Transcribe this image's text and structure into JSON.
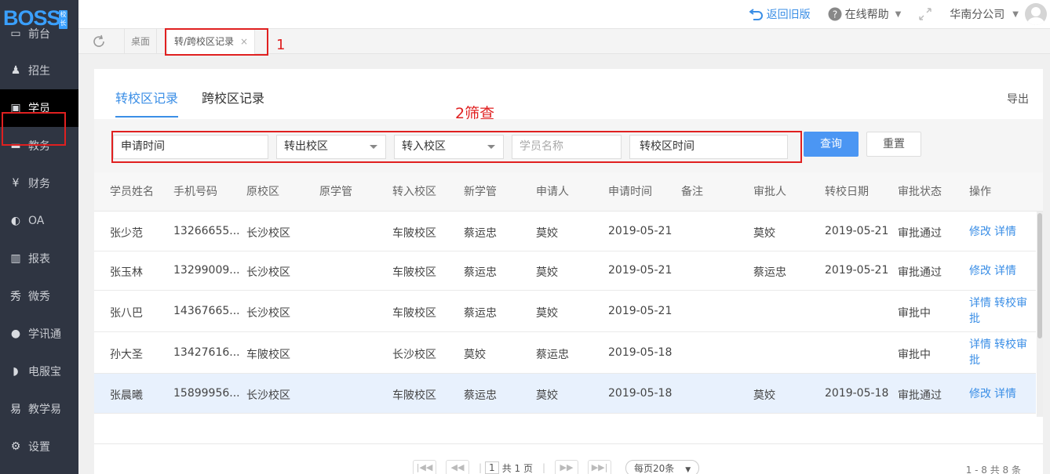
{
  "brand": {
    "logo": "BOSS",
    "badge": "校长"
  },
  "sidebar": {
    "items": [
      {
        "label": "前台",
        "icon": "window-icon"
      },
      {
        "label": "招生",
        "icon": "add-user-icon"
      },
      {
        "label": "学员",
        "icon": "student-card-icon"
      },
      {
        "label": "教务",
        "icon": "board-icon"
      },
      {
        "label": "财务",
        "icon": "yen-coin-icon"
      },
      {
        "label": "OA",
        "icon": "toggle-icon"
      },
      {
        "label": "报表",
        "icon": "bar-chart-icon"
      },
      {
        "label": "微秀",
        "icon": "wechat-show-icon"
      },
      {
        "label": "学讯通",
        "icon": "location-pin-icon"
      },
      {
        "label": "电服宝",
        "icon": "phone-service-icon"
      },
      {
        "label": "教学易",
        "icon": "teaching-icon"
      },
      {
        "label": "设置",
        "icon": "gear-icon"
      }
    ],
    "active_index": 2
  },
  "topbar": {
    "back_label": "返回旧版",
    "help_label": "在线帮助",
    "company_label": "华南分公司"
  },
  "tabs": {
    "desk": "桌面",
    "current": "转/跨校区记录",
    "close": "×"
  },
  "annotations": {
    "one": "1",
    "two": "2筛查"
  },
  "subtabs": {
    "transfer": "转校区记录",
    "cross": "跨校区记录",
    "export": "导出"
  },
  "filters": {
    "apply_time": "申请时间",
    "out_campus": "转出校区",
    "in_campus": "转入校区",
    "student_placeholder": "学员名称",
    "transfer_time": "转校区时间",
    "query": "查询",
    "reset": "重置"
  },
  "table": {
    "headers": [
      "学员姓名",
      "手机号码",
      "原校区",
      "原学管",
      "转入校区",
      "新学管",
      "申请人",
      "申请时间",
      "备注",
      "审批人",
      "转校日期",
      "审批状态",
      "操作"
    ],
    "rows": [
      {
        "name": "张少范",
        "phone": "13266655...",
        "orig": "长沙校区",
        "orig_mgr": "",
        "target": "车陂校区",
        "new_mgr": "蔡运忠",
        "applicant": "莫姣",
        "apply_date": "2019-05-21",
        "note": "",
        "approver": "莫姣",
        "transfer_date": "2019-05-21",
        "status": "审批通过",
        "ops": [
          "修改",
          "详情"
        ]
      },
      {
        "name": "张玉林",
        "phone": "13299009...",
        "orig": "长沙校区",
        "orig_mgr": "",
        "target": "车陂校区",
        "new_mgr": "蔡运忠",
        "applicant": "莫姣",
        "apply_date": "2019-05-21",
        "note": "",
        "approver": "蔡运忠",
        "transfer_date": "2019-05-21",
        "status": "审批通过",
        "ops": [
          "修改",
          "详情"
        ]
      },
      {
        "name": "张八巴",
        "phone": "14367665...",
        "orig": "长沙校区",
        "orig_mgr": "",
        "target": "车陂校区",
        "new_mgr": "蔡运忠",
        "applicant": "莫姣",
        "apply_date": "2019-05-21",
        "note": "",
        "approver": "",
        "transfer_date": "",
        "status": "审批中",
        "ops": [
          "详情",
          "转校审批"
        ]
      },
      {
        "name": "孙大圣",
        "phone": "13427616...",
        "orig": "车陂校区",
        "orig_mgr": "",
        "target": "长沙校区",
        "new_mgr": "莫姣",
        "applicant": "蔡运忠",
        "apply_date": "2019-05-18",
        "note": "",
        "approver": "",
        "transfer_date": "",
        "status": "审批中",
        "ops": [
          "详情",
          "转校审批"
        ]
      },
      {
        "name": "张晨曦",
        "phone": "15899956...",
        "orig": "长沙校区",
        "orig_mgr": "",
        "target": "车陂校区",
        "new_mgr": "蔡运忠",
        "applicant": "莫姣",
        "apply_date": "2019-05-18",
        "note": "",
        "approver": "莫姣",
        "transfer_date": "2019-05-18",
        "status": "审批通过",
        "ops": [
          "修改",
          "详情"
        ]
      }
    ]
  },
  "pager": {
    "page": "1",
    "of_pages": "共 1 页",
    "page_size": "每页20条",
    "summary": "1 - 8   共 8 条"
  }
}
